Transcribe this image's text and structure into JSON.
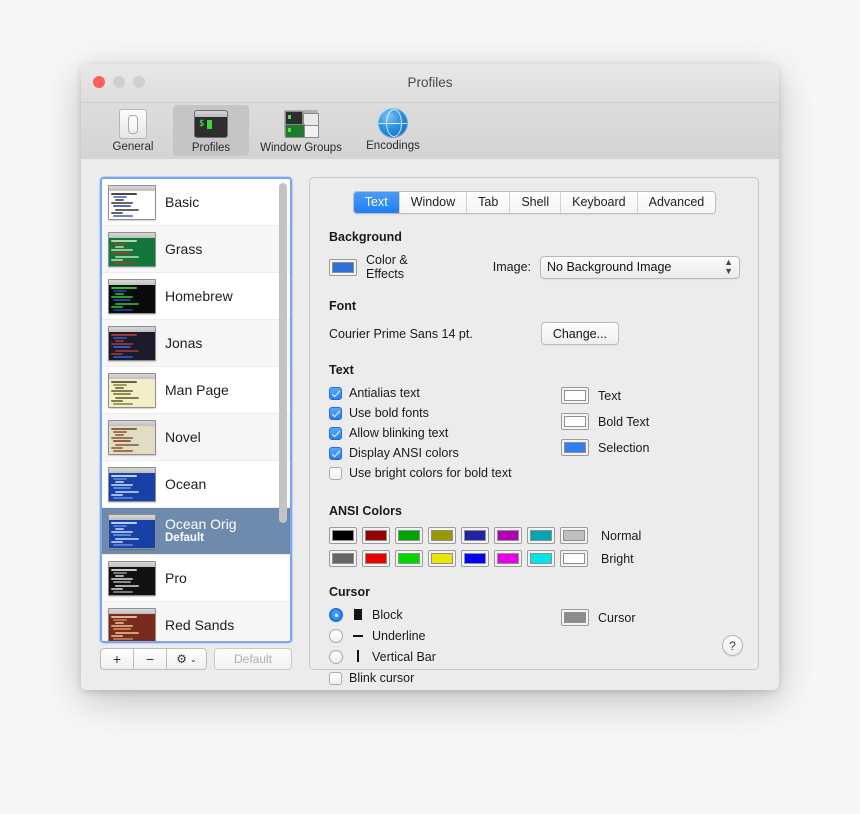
{
  "window": {
    "title": "Profiles",
    "traffic_lights": [
      "close-button",
      "minimize-button",
      "zoom-button"
    ]
  },
  "toolbar": {
    "items": [
      {
        "label": "General",
        "icon": "general-toggle-icon",
        "selected": false
      },
      {
        "label": "Profiles",
        "icon": "terminal-icon",
        "selected": true
      },
      {
        "label": "Window Groups",
        "icon": "window-groups-icon",
        "selected": false
      },
      {
        "label": "Encodings",
        "icon": "globe-icon",
        "selected": false
      }
    ]
  },
  "sidebar": {
    "profiles": [
      {
        "name": "Basic",
        "subtitle": "",
        "selected": false,
        "bg": "#ffffff",
        "fg": "#333333",
        "accent": "#3b5bbf"
      },
      {
        "name": "Grass",
        "subtitle": "",
        "selected": false,
        "bg": "#13773d",
        "fg": "#b9e6b9",
        "accent": "#a33c2a"
      },
      {
        "name": "Homebrew",
        "subtitle": "",
        "selected": false,
        "bg": "#0a0a0a",
        "fg": "#2fd22f",
        "accent": "#1f46c8"
      },
      {
        "name": "Jonas",
        "subtitle": "",
        "selected": false,
        "bg": "#1b1b2b",
        "fg": "#b03a3a",
        "accent": "#2c63d8"
      },
      {
        "name": "Man Page",
        "subtitle": "",
        "selected": false,
        "bg": "#f2eec8",
        "fg": "#5a5530",
        "accent": "#8a7f35"
      },
      {
        "name": "Novel",
        "subtitle": "",
        "selected": false,
        "bg": "#e3dcc4",
        "fg": "#7a5a3a",
        "accent": "#9a4a28"
      },
      {
        "name": "Ocean",
        "subtitle": "",
        "selected": false,
        "bg": "#1841a8",
        "fg": "#cfe0ff",
        "accent": "#5d93e8"
      },
      {
        "name": "Ocean Orig",
        "subtitle": "Default",
        "selected": true,
        "bg": "#1841a8",
        "fg": "#cfe0ff",
        "accent": "#5d93e8"
      },
      {
        "name": "Pro",
        "subtitle": "",
        "selected": false,
        "bg": "#111111",
        "fg": "#dcdcdc",
        "accent": "#9a9a9a"
      },
      {
        "name": "Red Sands",
        "subtitle": "",
        "selected": false,
        "bg": "#7a2b1e",
        "fg": "#e8c9a0",
        "accent": "#d08a55"
      }
    ],
    "actions": {
      "add_label": "+",
      "remove_label": "−",
      "gear_label": "⚙",
      "gear_chevron": "⌄",
      "default_label": "Default"
    }
  },
  "pane": {
    "tabs": [
      {
        "label": "Text",
        "active": true
      },
      {
        "label": "Window",
        "active": false
      },
      {
        "label": "Tab",
        "active": false
      },
      {
        "label": "Shell",
        "active": false
      },
      {
        "label": "Keyboard",
        "active": false
      },
      {
        "label": "Advanced",
        "active": false
      }
    ],
    "background": {
      "title": "Background",
      "color_effects_label": "Color & Effects",
      "color_effects_swatch": "#2f6fdb",
      "image_label": "Image:",
      "image_value": "No Background Image"
    },
    "font": {
      "title": "Font",
      "value": "Courier Prime Sans 14 pt.",
      "change_label": "Change..."
    },
    "text": {
      "title": "Text",
      "checkboxes": [
        {
          "label": "Antialias text",
          "checked": true
        },
        {
          "label": "Use bold fonts",
          "checked": true
        },
        {
          "label": "Allow blinking text",
          "checked": true
        },
        {
          "label": "Display ANSI colors",
          "checked": true
        },
        {
          "label": "Use bright colors for bold text",
          "checked": false
        }
      ],
      "wells": [
        {
          "label": "Text",
          "color": "#ffffff"
        },
        {
          "label": "Bold Text",
          "color": "#ffffff"
        },
        {
          "label": "Selection",
          "color": "#2f7ff0"
        }
      ]
    },
    "ansi": {
      "title": "ANSI Colors",
      "rows": [
        {
          "label": "Normal",
          "colors": [
            "#000000",
            "#990000",
            "#00a600",
            "#999900",
            "#2323a6",
            "#b300b3",
            "#00a6b2",
            "#bfbfbf"
          ]
        },
        {
          "label": "Bright",
          "colors": [
            "#666666",
            "#e60000",
            "#00d900",
            "#e6e600",
            "#0000ff",
            "#e600e6",
            "#00e6e6",
            "#fdfdfd"
          ]
        }
      ]
    },
    "cursor": {
      "title": "Cursor",
      "options": [
        {
          "label": "Block",
          "glyph": "block",
          "selected": true
        },
        {
          "label": "Underline",
          "glyph": "underline",
          "selected": false
        },
        {
          "label": "Vertical Bar",
          "glyph": "bar",
          "selected": false
        }
      ],
      "blink": {
        "label": "Blink cursor",
        "checked": false
      },
      "well": {
        "label": "Cursor",
        "color": "#8c8c8c"
      }
    },
    "help_label": "?"
  }
}
